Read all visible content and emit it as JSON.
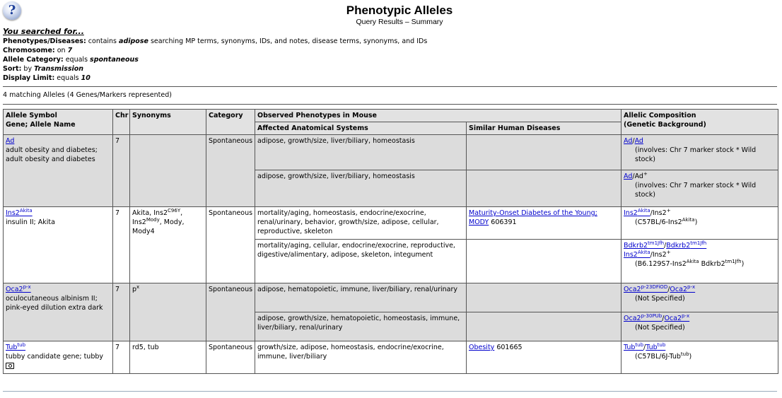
{
  "header": {
    "help_glyph": "?",
    "title": "Phenotypic Alleles",
    "subtitle": "Query Results – Summary"
  },
  "search": {
    "heading": "You searched for...",
    "criteria": [
      {
        "label": "Phenotypes/Diseases:",
        "pre": " contains ",
        "value": "adipose",
        "post": " searching MP terms, synonyms, IDs, and notes, disease terms, synonyms, and IDs"
      },
      {
        "label": "Chromosome:",
        "pre": " on ",
        "value": "7",
        "post": ""
      },
      {
        "label": "Allele Category:",
        "pre": " equals ",
        "value": "spontaneous",
        "post": ""
      },
      {
        "label": "Sort:",
        "pre": " by ",
        "value": "Transmission",
        "post": ""
      },
      {
        "label": "Display Limit:",
        "pre": " equals ",
        "value": "10",
        "post": ""
      }
    ]
  },
  "results_count": "4 matching Alleles (4 Genes/Markers represented)",
  "table": {
    "headers": {
      "allele_symbol_line1": "Allele Symbol",
      "allele_symbol_line2": "Gene; Allele Name",
      "chr": "Chr",
      "synonyms": "Synonyms",
      "category": "Category",
      "observed": "Observed Phenotypes in Mouse",
      "affected": "Affected Anatomical Systems",
      "similar": "Similar Human Diseases",
      "composition_line1": "Allelic Composition",
      "composition_line2": "(Genetic Background)"
    },
    "rows": {
      "ad": {
        "symbol": "Ad",
        "name": "adult obesity and diabetes; adult obesity and diabetes",
        "chr": "7",
        "synonyms": "",
        "category": "Spontaneous",
        "sub1": {
          "systems": "adipose, growth/size, liver/biliary, homeostasis",
          "diseases": "",
          "geno_a": "Ad",
          "geno_b": "Ad",
          "background": "(involves: Chr 7 marker stock * Wild stock)"
        },
        "sub2": {
          "systems": "adipose, growth/size, liver/biliary, homeostasis",
          "diseases": "",
          "geno_a": "Ad",
          "geno_b": "Ad",
          "geno_b_sup": "+",
          "background": "(involves: Chr 7 marker stock * Wild stock)"
        }
      },
      "ins2": {
        "symbol_base": "Ins2",
        "symbol_sup": "Akita",
        "name": "insulin II; Akita",
        "chr": "7",
        "syn_1": "Akita, Ins2",
        "syn_1_sup": "C96Y",
        "syn_2": ", Ins2",
        "syn_2_sup": "Mody",
        "syn_3": ", Mody, Mody4",
        "category": "Spontaneous",
        "sub1": {
          "systems": "mortality/aging, homeostasis, endocrine/exocrine, renal/urinary, behavior, growth/size, adipose, cellular, reproductive, skeleton",
          "disease_link": "Maturity-Onset Diabetes of the Young; MODY",
          "disease_id": " 606391",
          "geno_a": "Ins2",
          "geno_a_sup": "Akita",
          "geno_sep": "/Ins2",
          "geno_sep_sup": "+",
          "bg_pre": "(C57BL/6-Ins2",
          "bg_sup": "Akita",
          "bg_post": ")"
        },
        "sub2": {
          "systems": "mortality/aging, cellular, endocrine/exocrine, reproductive, digestive/alimentary, adipose, skeleton, integument",
          "diseases": "",
          "geno1_a": "Bdkrb2",
          "geno1_a_sup": "tm1Jfh",
          "geno1_b": "Bdkrb2",
          "geno1_b_sup": "tm1Jfh",
          "geno2_a": "Ins2",
          "geno2_a_sup": "Akita",
          "geno2_sep": "/Ins2",
          "geno2_sep_sup": "+",
          "bg_pre": "(B6.129S7-Ins2",
          "bg_sup": "Akita",
          "bg_mid": " Bdkrb2",
          "bg_sup2": "tm1Jfh",
          "bg_post": ")"
        }
      },
      "oca2": {
        "symbol_base": "Oca2",
        "symbol_sup": "p-x",
        "name": "oculocutaneous albinism II; pink-eyed dilution extra dark",
        "chr": "7",
        "syn_base": "p",
        "syn_sup": "x",
        "category": "Spontaneous",
        "sub1": {
          "systems": "adipose, hematopoietic, immune, liver/biliary, renal/urinary",
          "diseases": "",
          "geno_a": "Oca2",
          "geno_a_sup": "p-23DFiOD",
          "geno_b": "Oca2",
          "geno_b_sup": "p-x",
          "background": "(Not Specified)"
        },
        "sub2": {
          "systems": "adipose, growth/size, hematopoietic, homeostasis, immune, liver/biliary, renal/urinary",
          "diseases": "",
          "geno_a": "Oca2",
          "geno_a_sup": "p-30PUb",
          "geno_b": "Oca2",
          "geno_b_sup": "p-x",
          "background": "(Not Specified)"
        }
      },
      "tub": {
        "symbol_base": "Tub",
        "symbol_sup": "tub",
        "name": "tubby candidate gene; tubby",
        "chr": "7",
        "synonyms": "rd5, tub",
        "category": "Spontaneous",
        "systems": "growth/size, adipose, homeostasis, endocrine/exocrine, immune, liver/biliary",
        "disease_link": "Obesity",
        "disease_id": " 601665",
        "geno_a": "Tub",
        "geno_a_sup": "tub",
        "geno_b": "Tub",
        "geno_b_sup": "tub",
        "bg_pre": "(C57BL/6J-Tub",
        "bg_sup": "tub",
        "bg_post": ")"
      }
    }
  }
}
